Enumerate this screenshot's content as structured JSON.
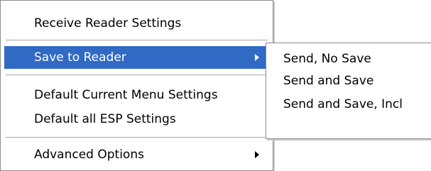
{
  "menu": {
    "items": [
      {
        "label": "Receive Reader Settings"
      },
      {
        "label": "Save to Reader"
      },
      {
        "label": "Default Current Menu Settings"
      },
      {
        "label": "Default all ESP Settings"
      },
      {
        "label": "Advanced Options"
      }
    ],
    "highlight_color": "#316ac5"
  },
  "submenu": {
    "items": [
      {
        "label": "Send, No Save"
      },
      {
        "label": "Send and Save"
      },
      {
        "label": "Send and Save, Incl"
      }
    ]
  },
  "icons": {
    "submenu_arrow": "chevron-right-icon"
  }
}
